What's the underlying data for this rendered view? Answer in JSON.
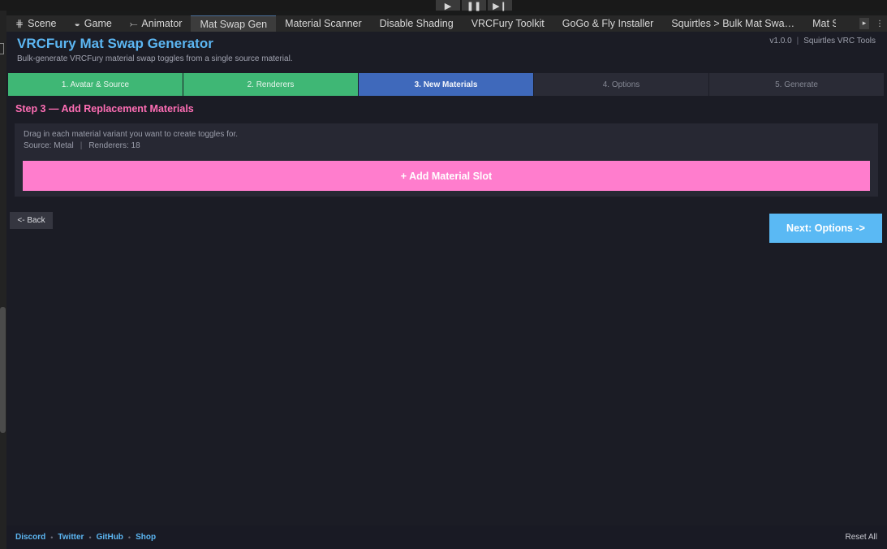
{
  "playbar": {
    "play_icon": "▶",
    "pause_icon": "❚❚",
    "step_icon": "▶❙"
  },
  "tabs": [
    {
      "label": "Scene",
      "icon": "⋕"
    },
    {
      "label": "Game",
      "icon": "◒"
    },
    {
      "label": "Animator",
      "icon": "⤚"
    },
    {
      "label": "Mat Swap Gen",
      "icon": ""
    },
    {
      "label": "Material Scanner",
      "icon": ""
    },
    {
      "label": "Disable Shading",
      "icon": ""
    },
    {
      "label": "VRCFury Toolkit",
      "icon": ""
    },
    {
      "label": "GoGo & Fly Installer",
      "icon": ""
    },
    {
      "label": "Squirtles > Bulk Mat Swa…",
      "icon": ""
    },
    {
      "label": "Mat S",
      "icon": ""
    }
  ],
  "tab_controls": {
    "scroll_icon": "▸",
    "menu_icon": "⋮"
  },
  "header": {
    "title": "VRCFury Mat Swap Generator",
    "subtitle": "Bulk-generate VRCFury material swap toggles from a single source material.",
    "version": "v1.0.0",
    "version_sep": "|",
    "brand": "Squirtles VRC Tools"
  },
  "steps": [
    {
      "label": "1. Avatar & Source",
      "state": "done"
    },
    {
      "label": "2. Renderers",
      "state": "done"
    },
    {
      "label": "3. New Materials",
      "state": "current"
    },
    {
      "label": "4. Options",
      "state": "todo"
    },
    {
      "label": "5. Generate",
      "state": "todo"
    }
  ],
  "section": {
    "title": "Step 3 — Add Replacement Materials",
    "hint": "Drag in each material variant you want to create toggles for.",
    "source": "Source: Metal",
    "meta_sep": "|",
    "renderers": "Renderers: 18",
    "add_button": "+ Add Material Slot"
  },
  "nav": {
    "back": "<- Back",
    "next": "Next: Options  ->"
  },
  "footer": {
    "links": [
      "Discord",
      "Twitter",
      "GitHub",
      "Shop"
    ],
    "bullet": "•",
    "reset": "Reset All"
  },
  "colors": {
    "accent_blue": "#5cb6f2",
    "accent_pink": "#ff6eb5",
    "step_done": "#3fb775",
    "step_current": "#3f69bb",
    "add_button": "#ff7dcd"
  }
}
